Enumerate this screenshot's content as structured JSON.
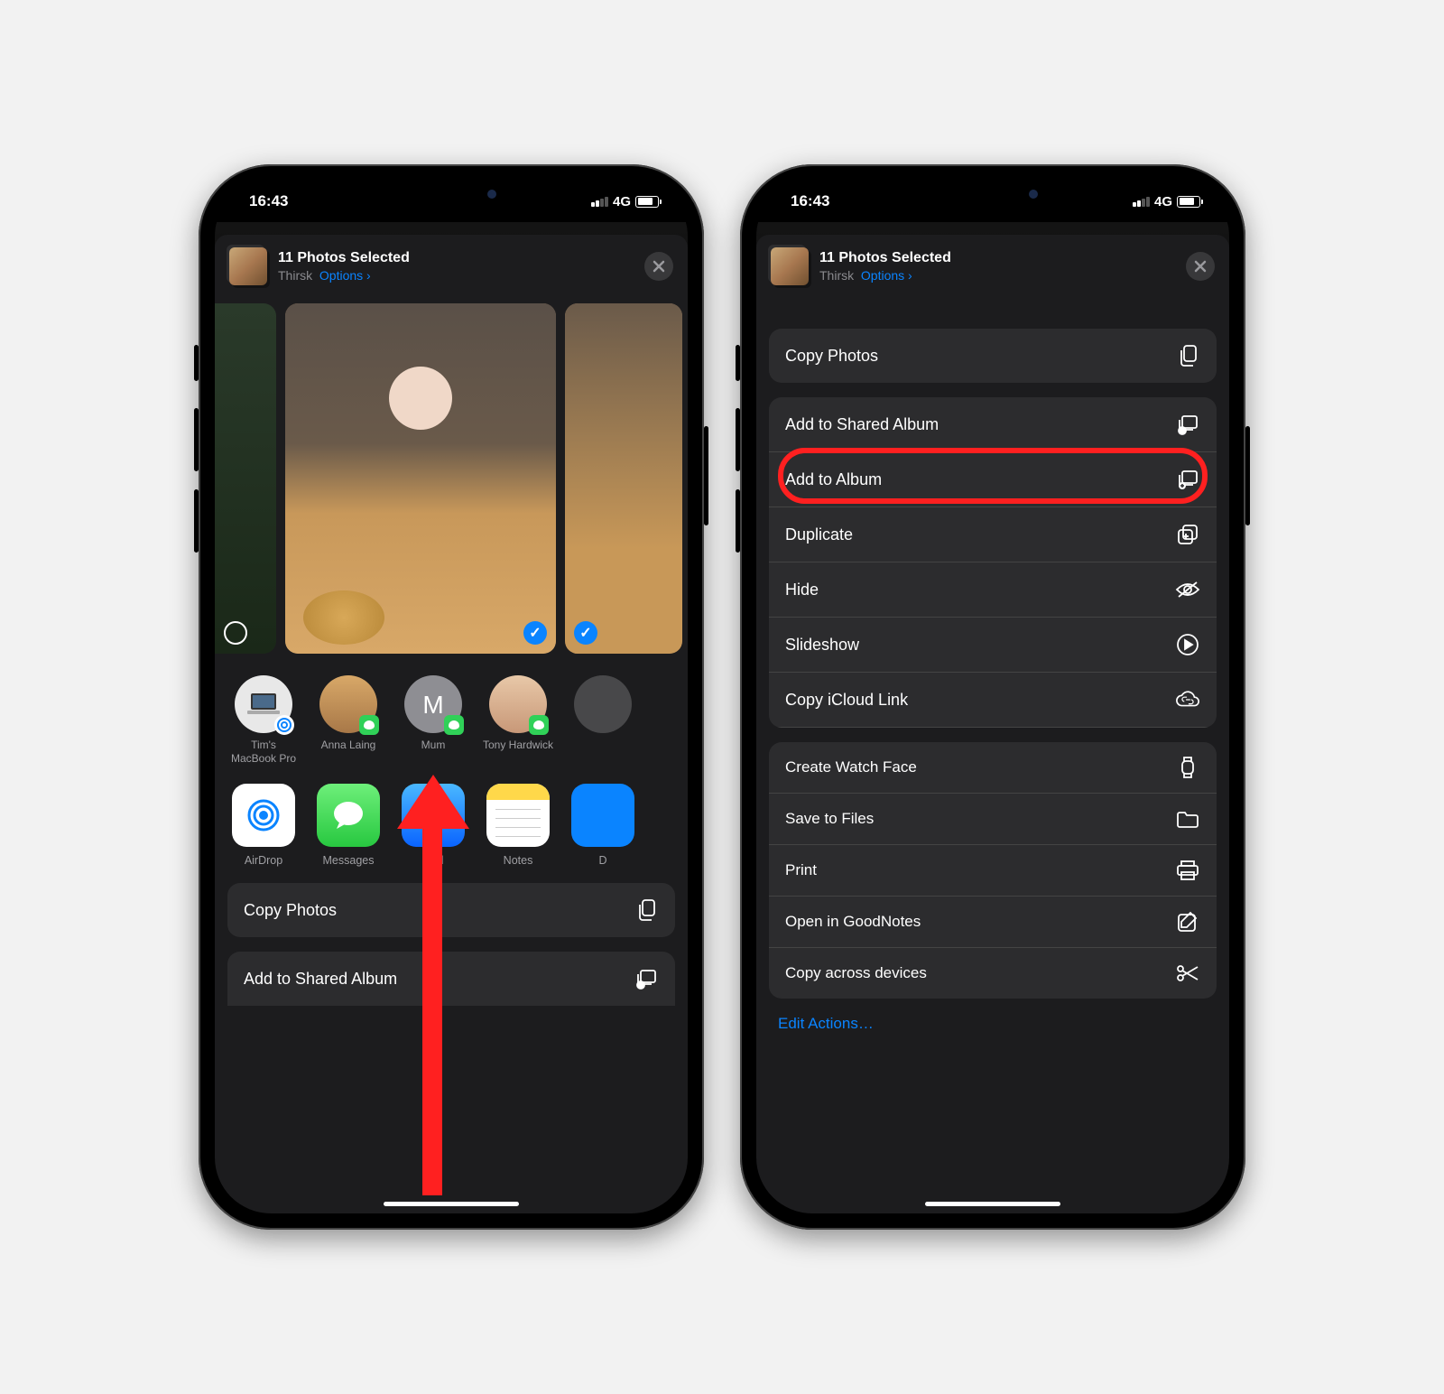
{
  "status": {
    "time": "16:43",
    "network": "4G"
  },
  "header": {
    "title": "11 Photos Selected",
    "location": "Thirsk",
    "options": "Options",
    "chevron": "›"
  },
  "people": [
    {
      "name": "Tim's MacBook Pro",
      "bg": "#e8e8e8",
      "badge": "airdrop",
      "letter": ""
    },
    {
      "name": "Anna Laing",
      "bg": "linear-gradient(#d8a868,#a87848)",
      "badge": "msg",
      "letter": ""
    },
    {
      "name": "Mum",
      "bg": "#8e8e93",
      "badge": "msg",
      "letter": "M"
    },
    {
      "name": "Tony Hardwick",
      "bg": "linear-gradient(#d8b898,#a87858)",
      "badge": "msg",
      "letter": ""
    }
  ],
  "apps": [
    {
      "name": "AirDrop",
      "bg": "#ffffff",
      "fg": "#0a84ff"
    },
    {
      "name": "Messages",
      "bg": "linear-gradient(#5dea6a,#28c840)",
      "fg": "#fff"
    },
    {
      "name": "Mail",
      "bg": "linear-gradient(#3ea8ff,#0a64ff)",
      "fg": "#fff"
    },
    {
      "name": "Notes",
      "bg": "linear-gradient(#fff 70%,#ffd84a 70%)",
      "fg": "#888"
    },
    {
      "name": "D",
      "bg": "#0a84ff",
      "fg": "#fff"
    }
  ],
  "left_actions": {
    "copy_photos": "Copy Photos",
    "add_shared": "Add to Shared Album"
  },
  "right_actions": {
    "group1": {
      "copy_photos": "Copy Photos"
    },
    "group2": {
      "add_shared": "Add to Shared Album",
      "add_album": "Add to Album",
      "duplicate": "Duplicate",
      "hide": "Hide",
      "slideshow": "Slideshow",
      "copy_icloud": "Copy iCloud Link"
    },
    "group3": {
      "watch_face": "Create Watch Face",
      "save_files": "Save to Files",
      "print": "Print",
      "goodnotes": "Open in GoodNotes",
      "copy_devices": "Copy across devices"
    },
    "edit": "Edit Actions…"
  }
}
